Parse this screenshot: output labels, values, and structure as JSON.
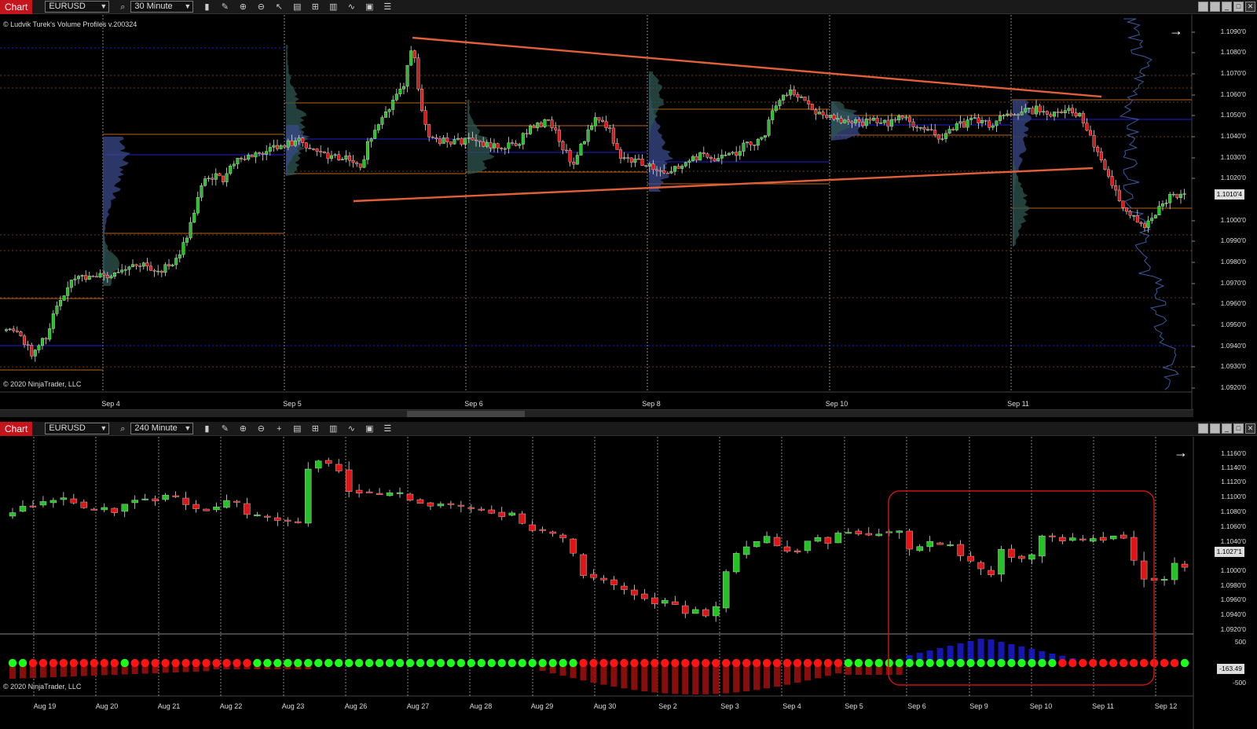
{
  "top_chart": {
    "tab_label": "Chart",
    "instrument": "EURUSD",
    "timeframe": "30 Minute",
    "indicator_label": "© Ludvik Turek's Volume Profiles v.200324",
    "credit": "© 2020 NinjaTrader, LLC",
    "last_price": "1.1010'4",
    "price_labels": [
      "1.1090'0",
      "1.1080'0",
      "1.1070'0",
      "1.1060'0",
      "1.1050'0",
      "1.1040'0",
      "1.1030'0",
      "1.1020'0",
      "1.1010'4",
      "1.1000'0",
      "1.0990'0",
      "1.0980'0",
      "1.0970'0",
      "1.0960'0",
      "1.0950'0",
      "1.0940'0",
      "1.0930'0",
      "1.0920'0"
    ],
    "date_labels": [
      "Sep 4",
      "Sep 5",
      "Sep 6",
      "Sep 8",
      "Sep 10",
      "Sep 11"
    ]
  },
  "bottom_chart": {
    "tab_label": "Chart",
    "instrument": "EURUSD",
    "timeframe": "240 Minute",
    "credit": "© 2020 NinjaTrader, LLC",
    "last_price": "1.1027'1",
    "indicator_value": "-163.49",
    "price_labels": [
      "1.1160'0",
      "1.1140'0",
      "1.1120'0",
      "1.1100'0",
      "1.1080'0",
      "1.1060'0",
      "1.1040'0",
      "1.1027'1",
      "1.1000'0",
      "1.0980'0",
      "1.0960'0",
      "1.0940'0",
      "1.0920'0"
    ],
    "indicator_labels": [
      "500",
      "-500"
    ],
    "date_labels": [
      "Aug 19",
      "Aug 20",
      "Aug 21",
      "Aug 22",
      "Aug 23",
      "Aug 26",
      "Aug 27",
      "Aug 28",
      "Aug 29",
      "Aug 30",
      "Sep 2",
      "Sep 3",
      "Sep 4",
      "Sep 5",
      "Sep 6",
      "Sep 9",
      "Sep 10",
      "Sep 11",
      "Sep 12"
    ]
  },
  "colors": {
    "bull": "#22c322",
    "bear": "#e01515",
    "trendline": "#e0603a",
    "poc_blue": "#2020d0",
    "value_area_orange": "#b8661a",
    "dot_green": "#19ff19",
    "dot_red": "#ff1414",
    "highlight_box": "#c81414"
  },
  "icons": [
    "search-icon",
    "bars-icon",
    "pencil-icon",
    "zoom-in-icon",
    "zoom-out-icon",
    "cursor-icon",
    "data-box-icon",
    "properties-icon",
    "templates-icon",
    "drawing-tools-icon",
    "calculator-icon",
    "list-icon"
  ]
}
